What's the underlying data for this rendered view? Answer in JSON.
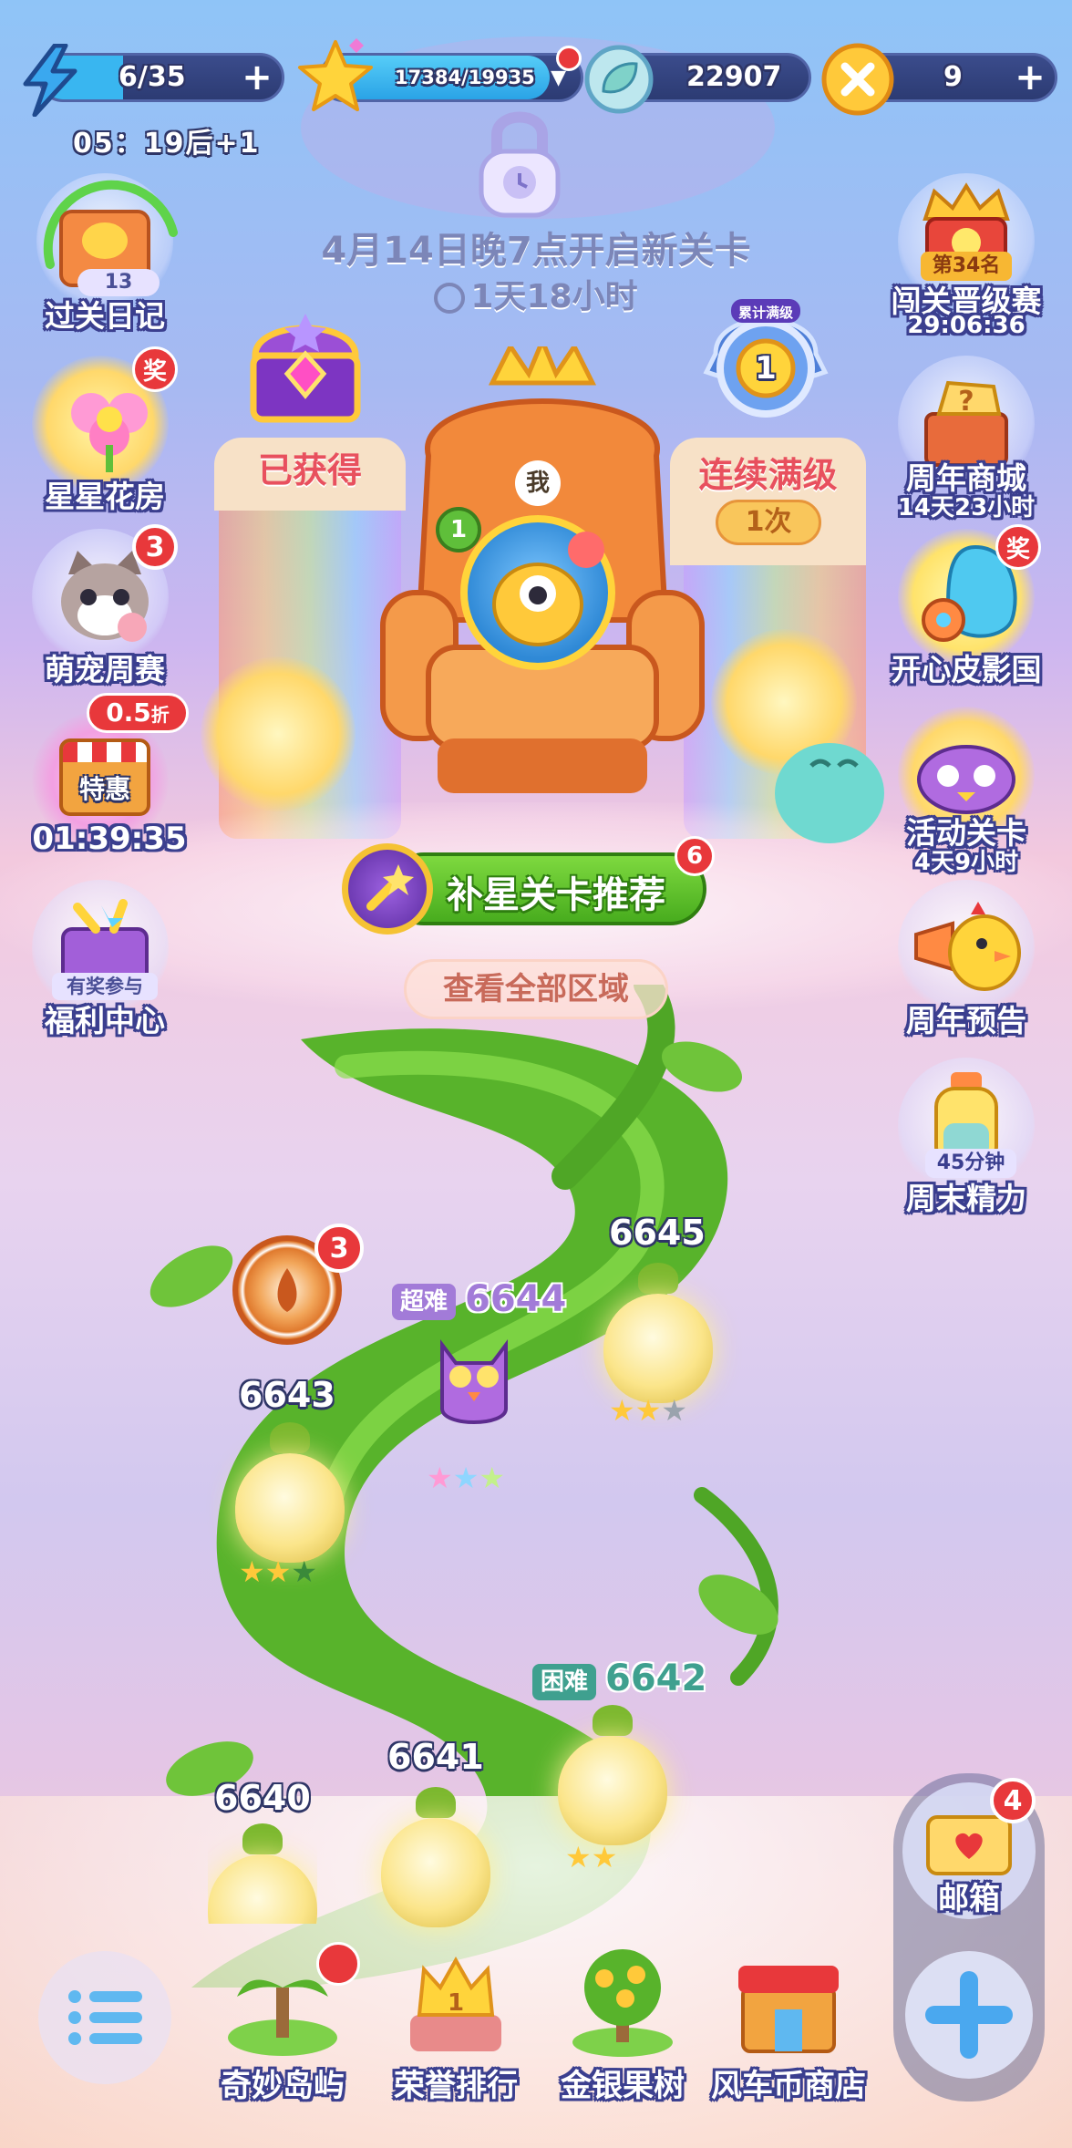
{
  "top_bar": {
    "energy": "6/35",
    "energy_timer": "05：19后+1",
    "stars": "17384/19935",
    "gems": "22907",
    "coins": "9",
    "plus_symbol": "+"
  },
  "unlock": {
    "title": "4月14日晚7点开启新关卡",
    "countdown": "1天18小时"
  },
  "left_buttons": [
    {
      "label": "过关日记",
      "badge": "13"
    },
    {
      "label": "星星花房",
      "badge": "奖"
    },
    {
      "label": "萌宠周赛",
      "badge": "3"
    },
    {
      "label": "特惠",
      "discount": "0.5",
      "discount_unit": "折",
      "timer": "01:39:35"
    },
    {
      "label": "福利中心",
      "tag": "有奖参与"
    }
  ],
  "right_buttons": [
    {
      "label": "闯关晋级赛",
      "rank": "第34名",
      "timer": "29:06:36"
    },
    {
      "label": "周年商城",
      "timer": "14天23小时"
    },
    {
      "label": "开心皮影国",
      "badge": "奖"
    },
    {
      "label": "活动关卡",
      "timer": "4天9小时"
    },
    {
      "label": "周年预告"
    },
    {
      "label": "周末精力",
      "tag": "45分钟"
    }
  ],
  "throne": {
    "left_pillar": "已获得",
    "right_pillar": "连续满级",
    "right_medal_tag": "累计满级",
    "right_medal_number": "1",
    "right_count": "1次",
    "me_label": "我",
    "player_level": "1"
  },
  "recommend_button": {
    "label": "补星关卡推荐",
    "badge": "6"
  },
  "view_all_button": "查看全部区域",
  "levels": [
    {
      "number": "6645",
      "stars": 2
    },
    {
      "number": "6644",
      "difficulty": "超难",
      "stars": 3
    },
    {
      "number": "6643",
      "stars": 2
    },
    {
      "number": "6642",
      "difficulty": "困难",
      "stars": 2
    },
    {
      "number": "6641"
    },
    {
      "number": "6640"
    }
  ],
  "wheel_badge": "3",
  "bottom_nav": [
    {
      "label": "奇妙岛屿"
    },
    {
      "label": "荣誉排行",
      "crown_number": "1"
    },
    {
      "label": "金银果树"
    },
    {
      "label": "风车币商店"
    }
  ],
  "mailbox": {
    "label": "邮箱",
    "badge": "4"
  },
  "colors": {
    "green_button": "#5cc326",
    "red_badge": "#e8383b",
    "outline": "#3b3f8f",
    "gold": "#f5c234"
  }
}
